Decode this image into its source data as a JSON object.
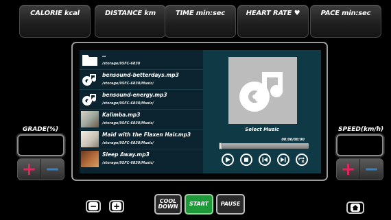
{
  "metrics": {
    "calorie": "CALORIE kcal",
    "distance": "DISTANCE km",
    "time": "TIME min:sec",
    "heart_rate": "HEART RATE ♥",
    "pace": "PACE min:sec"
  },
  "grade": {
    "label": "GRADE(%)"
  },
  "speed": {
    "label": "SPEED(km/h)"
  },
  "playlist": [
    {
      "title": "..",
      "path": "/storage/95FC-6838",
      "thumb": "folder-icon"
    },
    {
      "title": "bensound-betterdays.mp3",
      "path": "/storage/95FC-6838/Music/",
      "thumb": "music-disc-icon"
    },
    {
      "title": "bensound-energy.mp3",
      "path": "/storage/95FC-6838/Music/",
      "thumb": "music-disc-icon"
    },
    {
      "title": "Kalimba.mp3",
      "path": "/storage/95FC-6838/Music/",
      "thumb": "album-art"
    },
    {
      "title": "Maid with the Flaxen Hair.mp3",
      "path": "/storage/95FC-6838/Music/",
      "thumb": "album-art"
    },
    {
      "title": "Sleep Away.mp3",
      "path": "/storage/95FC-6838/Music/",
      "thumb": "album-art"
    }
  ],
  "player": {
    "status": "Select Music",
    "time": "00:00/00:00",
    "progress": 0
  },
  "actions": {
    "cool_down_line1": "COOL",
    "cool_down_line2": "DOWN",
    "start": "START",
    "pause": "PAUSE"
  },
  "colors": {
    "start_green": "#1f9a3a",
    "plus_red": "#e3245c",
    "minus_blue": "#3f7fbf",
    "screen_bg": "#0f3945"
  }
}
